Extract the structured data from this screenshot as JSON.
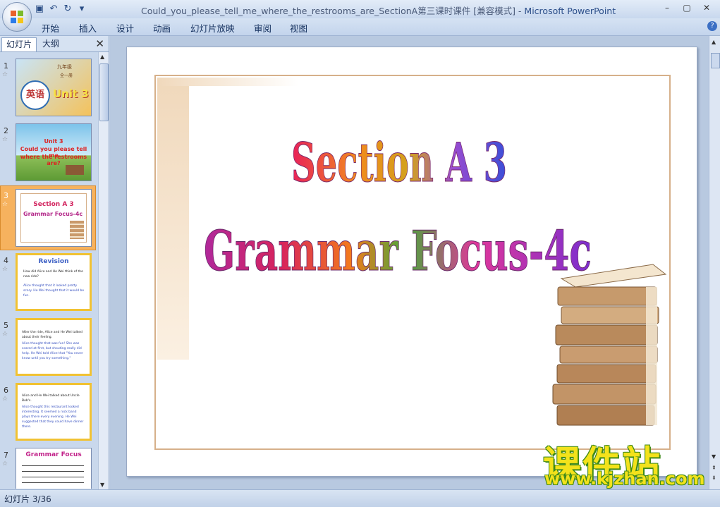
{
  "window": {
    "title": "Could_you_please_tell_me_where_the_restrooms_are_SectionA第三课时课件 [兼容模式]",
    "separator": " - ",
    "app_name": "Microsoft PowerPoint"
  },
  "ribbon": {
    "tabs": [
      "开始",
      "插入",
      "设计",
      "动画",
      "幻灯片放映",
      "审阅",
      "视图"
    ]
  },
  "panel": {
    "tab_slides": "幻灯片",
    "tab_outline": "大纲",
    "slides": [
      {
        "num": "1",
        "subject": "英语",
        "unit": "Unit 3",
        "grade": "九年级",
        "volume": "全一册"
      },
      {
        "num": "2",
        "line1": "Unit 3",
        "line2": "Could you please tell me",
        "line3": "where the restrooms are?"
      },
      {
        "num": "3",
        "line1": "Section A 3",
        "line2": "Grammar Focus-4c"
      },
      {
        "num": "4",
        "heading": "Revision",
        "q": "How did Alice and He Wei think of the new ride?",
        "a": "Alice thought that it looked pretty scary. He Wei thought that it would be fun."
      },
      {
        "num": "5",
        "q": "After the ride, Alice and He Wei talked about their feeling.",
        "a": "Alice thought that was fun! She was scared at first, but shouting really did help. He Wei told Alice that \"You never know until you try something.\""
      },
      {
        "num": "6",
        "q": "Alice and He Wei talked about Uncle Bob's.",
        "a": "Alice thought this restaurant looked interesting. It seemed a rock band plays there every evening. He Wei suggested that they could have dinner there."
      },
      {
        "num": "7",
        "heading": "Grammar Focus"
      }
    ]
  },
  "slide": {
    "title_line1": "Section A 3",
    "title_line2": "Grammar Focus-4c"
  },
  "watermark": {
    "cn": "课件站",
    "url": "www.kjzhan.com"
  },
  "status": {
    "text": "幻灯片 3/36"
  },
  "colors": {
    "selected_thumb": "#f6b25e",
    "slide_border": "#d6b08a",
    "watermark_yellow": "#f3e21b"
  }
}
